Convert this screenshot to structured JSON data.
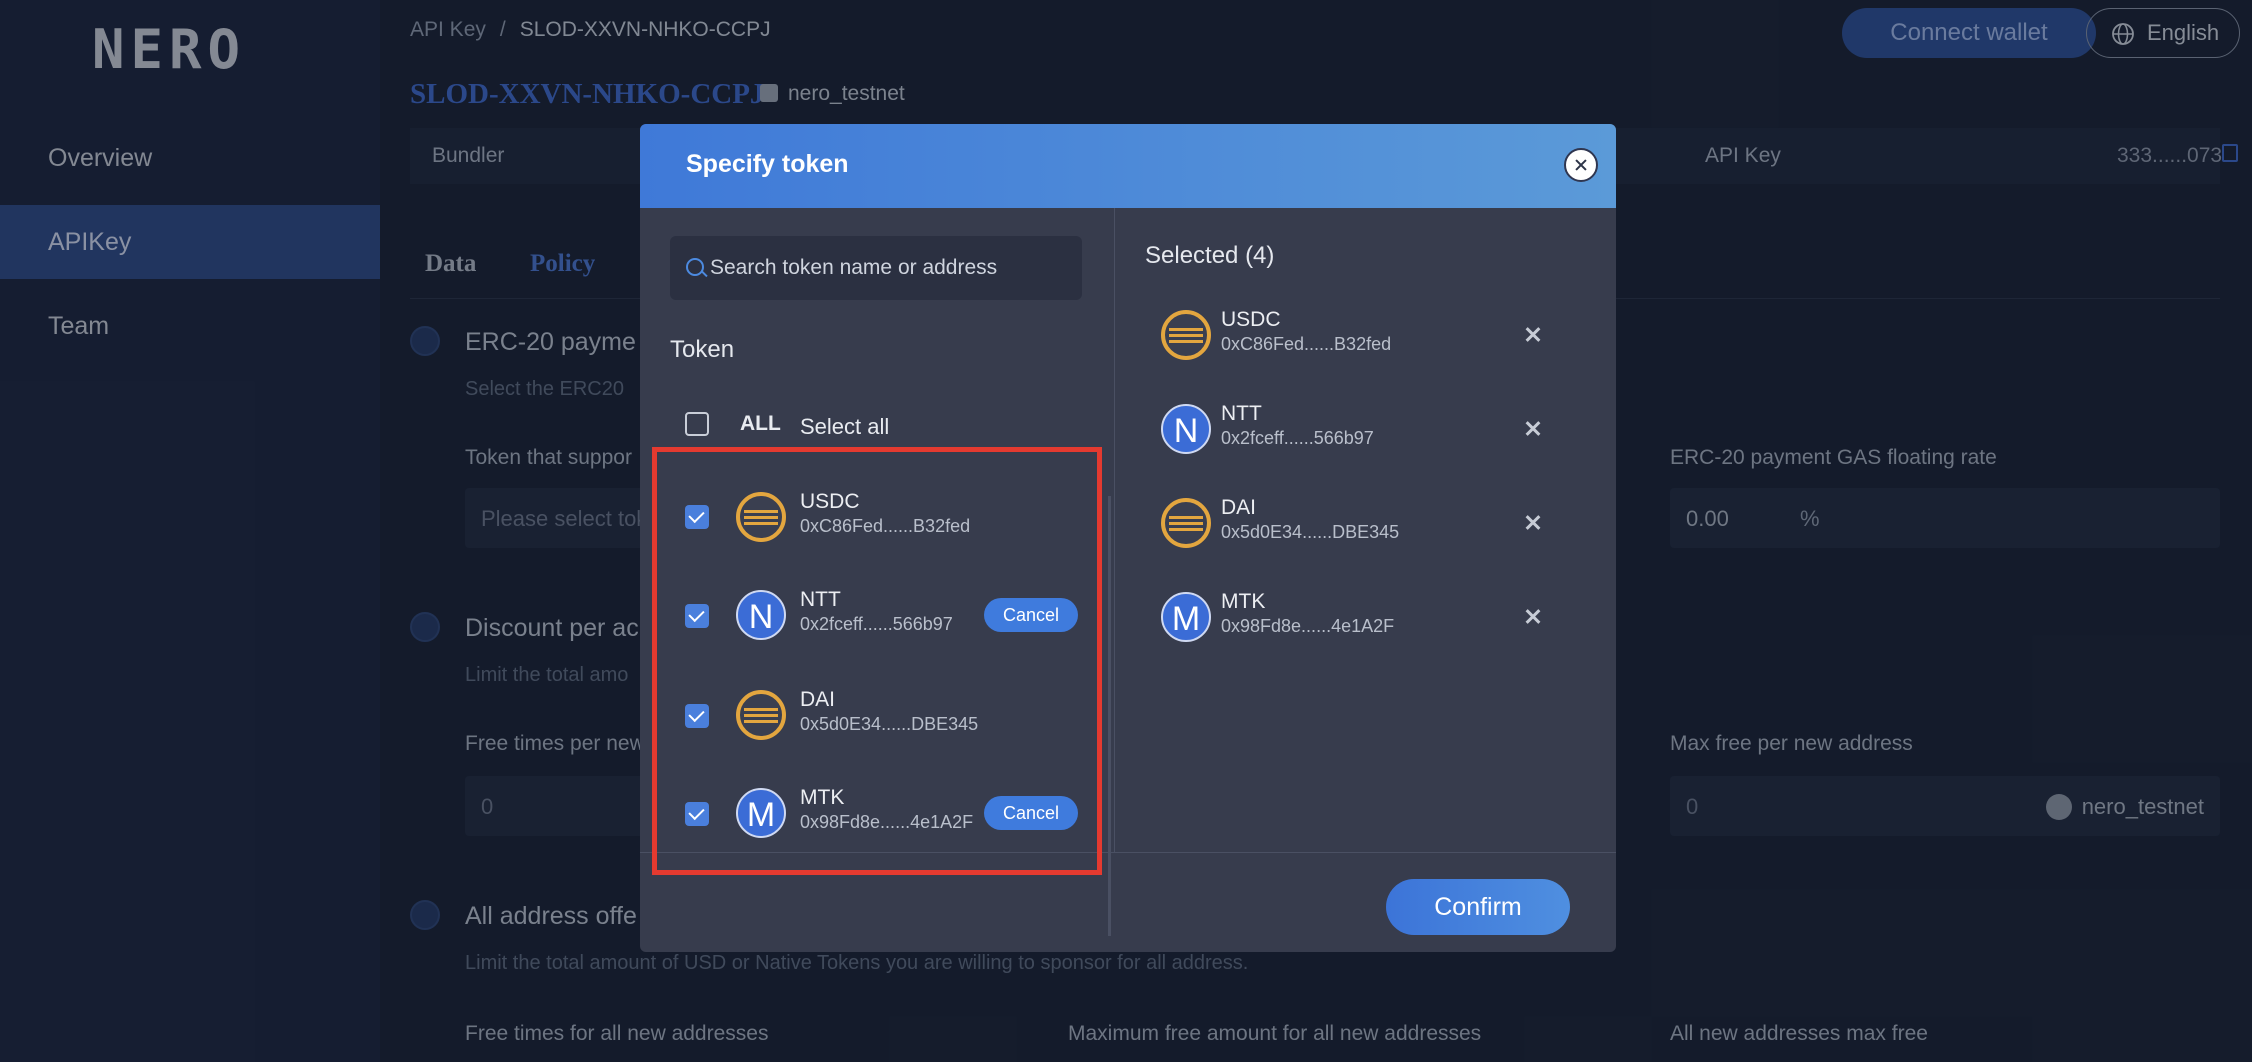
{
  "sidebar": {
    "logo": "NERO",
    "items": [
      {
        "label": "Overview",
        "active": false
      },
      {
        "label": "APIKey",
        "active": true
      },
      {
        "label": "Team",
        "active": false
      }
    ]
  },
  "header": {
    "breadcrumb_root": "API Key",
    "breadcrumb_sep": "/",
    "breadcrumb_current": "SLOD-XXVN-NHKO-CCPJ",
    "connect_wallet": "Connect wallet",
    "language": "English"
  },
  "key": {
    "title": "SLOD-XXVN-NHKO-CCPJ",
    "network": "nero_testnet"
  },
  "info_bar": {
    "bundler_label": "Bundler",
    "apikey_label": "API Key",
    "apikey_value": "333......073"
  },
  "tabs": [
    {
      "label": "Data",
      "active": false
    },
    {
      "label": "Policy",
      "active": true
    }
  ],
  "sections": {
    "erc20": {
      "title": "ERC-20 payme",
      "desc": "Select the ERC20",
      "token_label": "Token that suppor",
      "token_placeholder": "Please select tok",
      "gas_label": "ERC-20 payment GAS floating rate",
      "gas_value": "0.00",
      "gas_unit": "%"
    },
    "discount": {
      "title": "Discount per ac",
      "desc": "Limit the total amo",
      "free_label": "Free times per new",
      "free_value": "0",
      "max_label": "Max free per new address",
      "max_value": "0",
      "max_network": "nero_testnet"
    },
    "all_address": {
      "title": "All address offe",
      "desc": "Limit the total amount of USD or Native Tokens you are willing to sponsor for all address.",
      "label_1": "Free times for all new addresses",
      "label_2": "Maximum free amount for all new addresses",
      "label_3": "All new addresses max free"
    }
  },
  "modal": {
    "title": "Specify token",
    "search_placeholder": "Search token name or address",
    "token_heading": "Token",
    "all_label": "ALL",
    "select_all_label": "Select all",
    "tokens": [
      {
        "name": "USDC",
        "address": "0xC86Fed......B32fed",
        "icon": "coin-icon",
        "checked": true,
        "cancel": ""
      },
      {
        "name": "NTT",
        "address": "0x2fceff......566b97",
        "icon": "N",
        "checked": true,
        "cancel": "Cancel"
      },
      {
        "name": "DAI",
        "address": "0x5d0E34......DBE345",
        "icon": "coin-icon",
        "checked": true,
        "cancel": ""
      },
      {
        "name": "MTK",
        "address": "0x98Fd8e......4e1A2F",
        "icon": "M",
        "checked": true,
        "cancel": "Cancel"
      }
    ],
    "selected_heading": "Selected (4)",
    "selected": [
      {
        "name": "USDC",
        "address": "0xC86Fed......B32fed",
        "icon": "coin-icon"
      },
      {
        "name": "NTT",
        "address": "0x2fceff......566b97",
        "icon": "N"
      },
      {
        "name": "DAI",
        "address": "0x5d0E34......DBE345",
        "icon": "coin-icon"
      },
      {
        "name": "MTK",
        "address": "0x98Fd8e......4e1A2F",
        "icon": "M"
      }
    ],
    "confirm_label": "Confirm"
  },
  "colors": {
    "accent": "#3e68c8",
    "highlight_border": "#e43a30",
    "coin": "#e3a63f"
  }
}
